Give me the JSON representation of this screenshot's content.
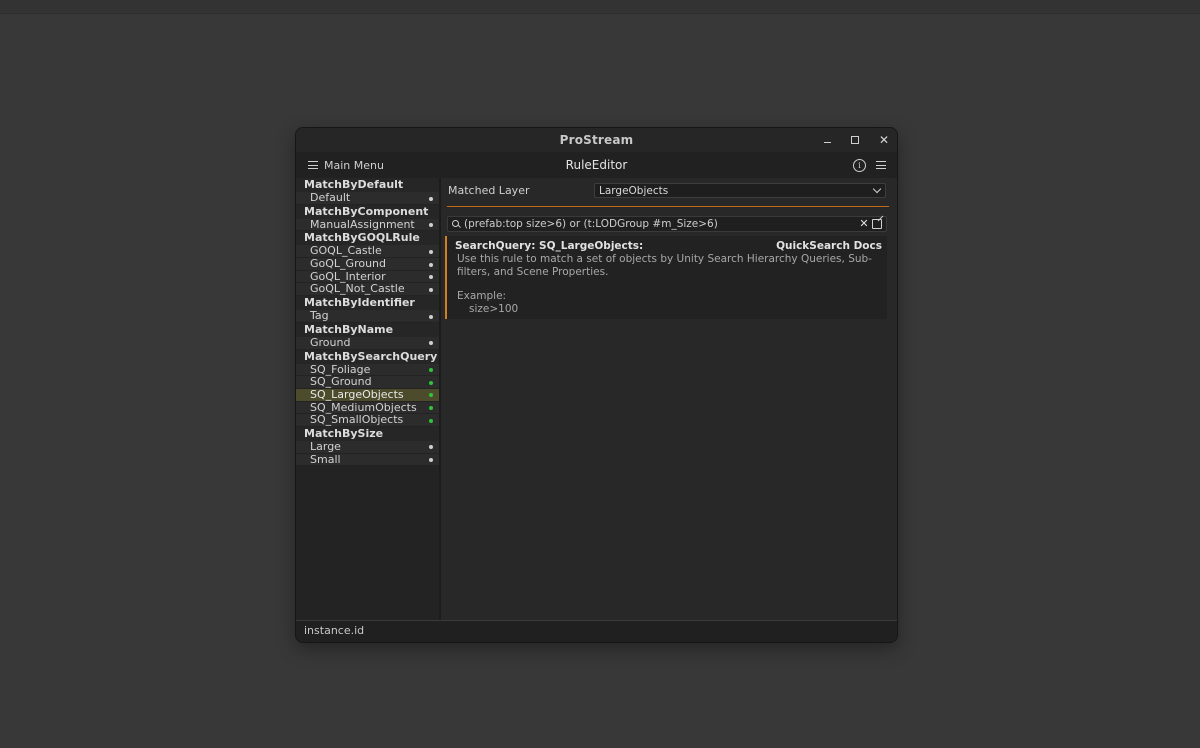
{
  "window": {
    "title": "ProStream",
    "minimize_symbol": "–",
    "maximize_symbol": "□",
    "close_symbol": "✕"
  },
  "toolbar": {
    "menu_label": "Main Menu",
    "center_title": "RuleEditor",
    "info_symbol": "i"
  },
  "sidebar": {
    "groups": [
      {
        "header": "MatchByDefault",
        "items": [
          {
            "label": "Default",
            "dot": "white"
          }
        ]
      },
      {
        "header": "MatchByComponent",
        "items": [
          {
            "label": "ManualAssignment",
            "dot": "white"
          }
        ]
      },
      {
        "header": "MatchByGOQLRule",
        "items": [
          {
            "label": "GOQL_Castle",
            "dot": "white"
          },
          {
            "label": "GoQL_Ground",
            "dot": "white"
          },
          {
            "label": "GoQL_Interior",
            "dot": "white"
          },
          {
            "label": "GoQL_Not_Castle",
            "dot": "white"
          }
        ]
      },
      {
        "header": "MatchByIdentifier",
        "items": [
          {
            "label": "Tag",
            "dot": "white"
          }
        ]
      },
      {
        "header": "MatchByName",
        "items": [
          {
            "label": "Ground",
            "dot": "white"
          }
        ]
      },
      {
        "header": "MatchBySearchQuery",
        "items": [
          {
            "label": "SQ_Foliage",
            "dot": "green"
          },
          {
            "label": "SQ_Ground",
            "dot": "green"
          },
          {
            "label": "SQ_LargeObjects",
            "dot": "green",
            "selected": true
          },
          {
            "label": "SQ_MediumObjects",
            "dot": "green"
          },
          {
            "label": "SQ_SmallObjects",
            "dot": "green"
          }
        ]
      },
      {
        "header": "MatchBySize",
        "items": [
          {
            "label": "Large",
            "dot": "white"
          },
          {
            "label": "Small",
            "dot": "white"
          }
        ]
      }
    ]
  },
  "main": {
    "matched_layer_label": "Matched Layer",
    "matched_layer_value": "LargeObjects",
    "search_query": "(prefab:top size>6) or (t:LODGroup #m_Size>6)",
    "clear_symbol": "✕",
    "help": {
      "title": "SearchQuery: SQ_LargeObjects:",
      "link": "QuickSearch Docs",
      "description": "Use this rule to match a set of objects by Unity Search Hierarchy Queries, Sub-filters, and Scene Properties.",
      "example_label": "Example:",
      "example_value": "size>100"
    }
  },
  "statusbar": {
    "text": "instance.id"
  },
  "colors": {
    "accent_orange": "#d2801e",
    "selection_bg": "#4c4b2c",
    "active_dot": "#2fc43a"
  }
}
